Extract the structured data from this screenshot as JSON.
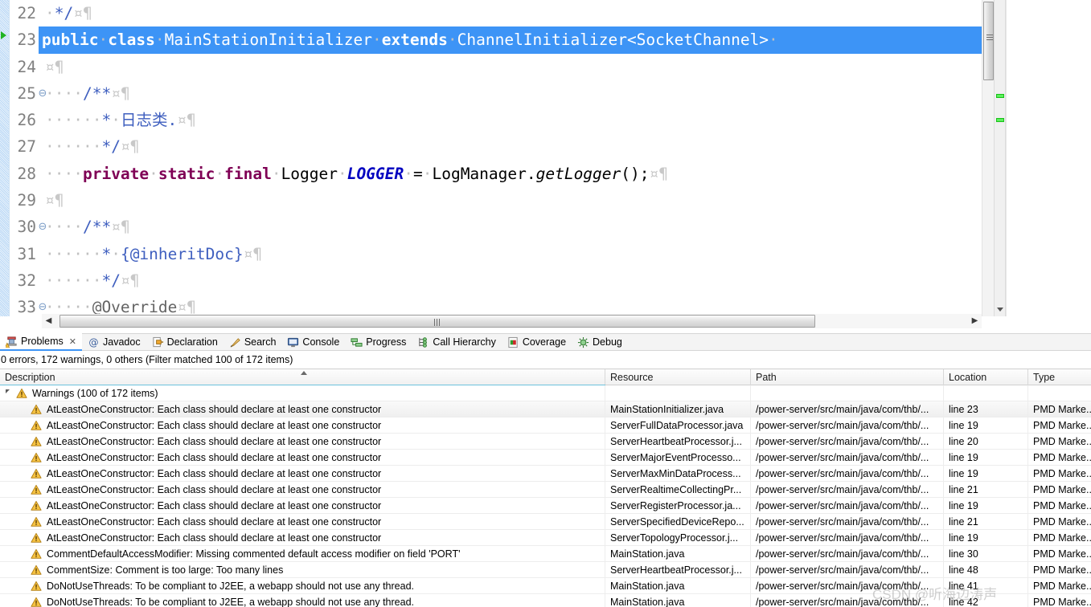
{
  "editor": {
    "lines": [
      {
        "num": "22",
        "fold": "",
        "highlighted": false,
        "segments": [
          {
            "t": "·",
            "c": "ws"
          },
          {
            "t": "*/",
            "c": "cmt"
          },
          {
            "t": "¤¶",
            "c": "pilcrow"
          }
        ]
      },
      {
        "num": "23",
        "fold": "",
        "highlighted": true,
        "segments": [
          {
            "t": "public",
            "c": "kw"
          },
          {
            "t": "·",
            "c": "ws"
          },
          {
            "t": "class",
            "c": "kw"
          },
          {
            "t": "·",
            "c": "ws"
          },
          {
            "t": "MainStationInitializer",
            "c": ""
          },
          {
            "t": "·",
            "c": "ws"
          },
          {
            "t": "extends",
            "c": "kw"
          },
          {
            "t": "·",
            "c": "ws"
          },
          {
            "t": "ChannelInitializer<SocketChannel>",
            "c": ""
          },
          {
            "t": "·",
            "c": "ws"
          }
        ]
      },
      {
        "num": "24",
        "fold": "",
        "highlighted": false,
        "segments": [
          {
            "t": "¤¶",
            "c": "pilcrow"
          }
        ]
      },
      {
        "num": "25",
        "fold": "⊖",
        "highlighted": false,
        "segments": [
          {
            "t": "····",
            "c": "ws"
          },
          {
            "t": "/**",
            "c": "cmt"
          },
          {
            "t": "¤¶",
            "c": "pilcrow"
          }
        ]
      },
      {
        "num": "26",
        "fold": "",
        "highlighted": false,
        "segments": [
          {
            "t": "······",
            "c": "ws"
          },
          {
            "t": "*",
            "c": "cmt"
          },
          {
            "t": "·",
            "c": "ws"
          },
          {
            "t": "日志类.",
            "c": "cmt"
          },
          {
            "t": "¤¶",
            "c": "pilcrow"
          }
        ]
      },
      {
        "num": "27",
        "fold": "",
        "highlighted": false,
        "segments": [
          {
            "t": "······",
            "c": "ws"
          },
          {
            "t": "*/",
            "c": "cmt"
          },
          {
            "t": "¤¶",
            "c": "pilcrow"
          }
        ]
      },
      {
        "num": "28",
        "fold": "",
        "highlighted": false,
        "segments": [
          {
            "t": "····",
            "c": "ws"
          },
          {
            "t": "private",
            "c": "kw"
          },
          {
            "t": "·",
            "c": "ws"
          },
          {
            "t": "static",
            "c": "kw"
          },
          {
            "t": "·",
            "c": "ws"
          },
          {
            "t": "final",
            "c": "kw"
          },
          {
            "t": "·",
            "c": "ws"
          },
          {
            "t": "Logger",
            "c": ""
          },
          {
            "t": "·",
            "c": "ws"
          },
          {
            "t": "LOGGER",
            "c": "static-field"
          },
          {
            "t": "·",
            "c": "ws"
          },
          {
            "t": "=",
            "c": ""
          },
          {
            "t": "·",
            "c": "ws"
          },
          {
            "t": "LogManager.",
            "c": ""
          },
          {
            "t": "getLogger",
            "c": "method"
          },
          {
            "t": "();",
            "c": ""
          },
          {
            "t": "¤¶",
            "c": "pilcrow"
          }
        ]
      },
      {
        "num": "29",
        "fold": "",
        "highlighted": false,
        "segments": [
          {
            "t": "¤¶",
            "c": "pilcrow"
          }
        ]
      },
      {
        "num": "30",
        "fold": "⊖",
        "highlighted": false,
        "segments": [
          {
            "t": "····",
            "c": "ws"
          },
          {
            "t": "/**",
            "c": "cmt"
          },
          {
            "t": "¤¶",
            "c": "pilcrow"
          }
        ]
      },
      {
        "num": "31",
        "fold": "",
        "highlighted": false,
        "segments": [
          {
            "t": "······",
            "c": "ws"
          },
          {
            "t": "*",
            "c": "cmt"
          },
          {
            "t": "·",
            "c": "ws"
          },
          {
            "t": "{@inheritDoc}",
            "c": "cmt"
          },
          {
            "t": "¤¶",
            "c": "pilcrow"
          }
        ]
      },
      {
        "num": "32",
        "fold": "",
        "highlighted": false,
        "segments": [
          {
            "t": "······",
            "c": "ws"
          },
          {
            "t": "*/",
            "c": "cmt"
          },
          {
            "t": "¤¶",
            "c": "pilcrow"
          }
        ]
      },
      {
        "num": "33",
        "fold": "⊖",
        "highlighted": false,
        "segments": [
          {
            "t": "·····",
            "c": "ws"
          },
          {
            "t": "@Override",
            "c": "ann"
          },
          {
            "t": "¤¶",
            "c": "pilcrow"
          }
        ]
      }
    ]
  },
  "view_tabs": [
    {
      "label": "Problems",
      "icon": "problems-icon",
      "active": true,
      "closable": true
    },
    {
      "label": "Javadoc",
      "icon": "javadoc-icon",
      "active": false,
      "closable": false
    },
    {
      "label": "Declaration",
      "icon": "declaration-icon",
      "active": false,
      "closable": false
    },
    {
      "label": "Search",
      "icon": "search-icon",
      "active": false,
      "closable": false
    },
    {
      "label": "Console",
      "icon": "console-icon",
      "active": false,
      "closable": false
    },
    {
      "label": "Progress",
      "icon": "progress-icon",
      "active": false,
      "closable": false
    },
    {
      "label": "Call Hierarchy",
      "icon": "call-hierarchy-icon",
      "active": false,
      "closable": false
    },
    {
      "label": "Coverage",
      "icon": "coverage-icon",
      "active": false,
      "closable": false
    },
    {
      "label": "Debug",
      "icon": "debug-icon",
      "active": false,
      "closable": false
    }
  ],
  "problems": {
    "status": "0 errors, 172 warnings, 0 others (Filter matched 100 of 172 items)",
    "columns": [
      "Description",
      "Resource",
      "Path",
      "Location",
      "Type"
    ],
    "group_label": "Warnings (100 of 172 items)",
    "rows": [
      {
        "description": "AtLeastOneConstructor: Each class should declare at least one constructor",
        "resource": "MainStationInitializer.java",
        "path": "/power-server/src/main/java/com/thb/...",
        "location": "line 23",
        "type": "PMD Marke..."
      },
      {
        "description": "AtLeastOneConstructor: Each class should declare at least one constructor",
        "resource": "ServerFullDataProcessor.java",
        "path": "/power-server/src/main/java/com/thb/...",
        "location": "line 19",
        "type": "PMD Marke..."
      },
      {
        "description": "AtLeastOneConstructor: Each class should declare at least one constructor",
        "resource": "ServerHeartbeatProcessor.j...",
        "path": "/power-server/src/main/java/com/thb/...",
        "location": "line 20",
        "type": "PMD Marke..."
      },
      {
        "description": "AtLeastOneConstructor: Each class should declare at least one constructor",
        "resource": "ServerMajorEventProcesso...",
        "path": "/power-server/src/main/java/com/thb/...",
        "location": "line 19",
        "type": "PMD Marke..."
      },
      {
        "description": "AtLeastOneConstructor: Each class should declare at least one constructor",
        "resource": "ServerMaxMinDataProcess...",
        "path": "/power-server/src/main/java/com/thb/...",
        "location": "line 19",
        "type": "PMD Marke..."
      },
      {
        "description": "AtLeastOneConstructor: Each class should declare at least one constructor",
        "resource": "ServerRealtimeCollectingPr...",
        "path": "/power-server/src/main/java/com/thb/...",
        "location": "line 21",
        "type": "PMD Marke..."
      },
      {
        "description": "AtLeastOneConstructor: Each class should declare at least one constructor",
        "resource": "ServerRegisterProcessor.ja...",
        "path": "/power-server/src/main/java/com/thb/...",
        "location": "line 19",
        "type": "PMD Marke..."
      },
      {
        "description": "AtLeastOneConstructor: Each class should declare at least one constructor",
        "resource": "ServerSpecifiedDeviceRepo...",
        "path": "/power-server/src/main/java/com/thb/...",
        "location": "line 21",
        "type": "PMD Marke..."
      },
      {
        "description": "AtLeastOneConstructor: Each class should declare at least one constructor",
        "resource": "ServerTopologyProcessor.j...",
        "path": "/power-server/src/main/java/com/thb/...",
        "location": "line 19",
        "type": "PMD Marke..."
      },
      {
        "description": "CommentDefaultAccessModifier: Missing commented default access modifier on field 'PORT'",
        "resource": "MainStation.java",
        "path": "/power-server/src/main/java/com/thb/...",
        "location": "line 30",
        "type": "PMD Marke..."
      },
      {
        "description": "CommentSize: Comment is too large: Too many lines",
        "resource": "ServerHeartbeatProcessor.j...",
        "path": "/power-server/src/main/java/com/thb/...",
        "location": "line 48",
        "type": "PMD Marke..."
      },
      {
        "description": "DoNotUseThreads: To be compliant to J2EE, a webapp should not use any thread.",
        "resource": "MainStation.java",
        "path": "/power-server/src/main/java/com/thb/...",
        "location": "line 41",
        "type": "PMD Marke..."
      },
      {
        "description": "DoNotUseThreads: To be compliant to J2EE, a webapp should not use any thread.",
        "resource": "MainStation.java",
        "path": "/power-server/src/main/java/com/thb/...",
        "location": "line 42",
        "type": "PMD Marke..."
      }
    ]
  },
  "watermark": {
    "text": "CSDN @听海边涛声"
  },
  "colors": {
    "selection": "#3d94f6",
    "keyword": "#7f0055",
    "comment": "#3f5fbf",
    "static_field": "#0000c0",
    "warning_icon": "#f0ad2e",
    "marker_green": "#5cf05c",
    "column_underline": "#6cc3dd"
  }
}
